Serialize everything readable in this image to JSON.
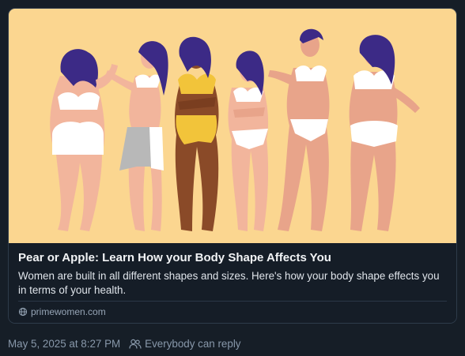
{
  "link_card": {
    "title": "Pear or Apple: Learn How your Body Shape Affects You",
    "description": "Women are built in all different shapes and sizes. Here's how your body shape effects you in terms of your health.",
    "domain": "primewomen.com",
    "image_icon": "illustration-six-women-body-shapes",
    "domain_icon": "globe-icon"
  },
  "post_meta": {
    "timestamp": "May 5, 2025 at 8:27 PM",
    "reply_setting": "Everybody can reply",
    "reply_icon": "people-icon"
  },
  "colors": {
    "background": "#161e27",
    "image_bg": "#fbd690",
    "title": "#f1f3f5",
    "muted": "#8898aa"
  }
}
